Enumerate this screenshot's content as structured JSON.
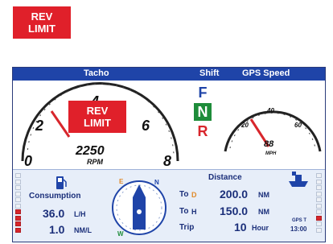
{
  "rev_limit_badge": {
    "line1": "REV",
    "line2": "LIMIT"
  },
  "header": {
    "tacho": "Tacho",
    "shift": "Shift",
    "gps_speed": "GPS Speed"
  },
  "tacho": {
    "ticks": [
      "0",
      "2",
      "4",
      "6",
      "8"
    ],
    "value": "2250",
    "unit": "RPM"
  },
  "shift": {
    "forward": "F",
    "neutral": "N",
    "reverse": "R",
    "active": "N"
  },
  "speedometer": {
    "ticks": [
      "20",
      "40",
      "60"
    ],
    "unit": "MPH",
    "reading": "88"
  },
  "consumption": {
    "label": "Consumption",
    "rate_value": "36.0",
    "rate_unit": "L/H",
    "economy_value": "1.0",
    "economy_unit": "NM/L"
  },
  "distance": {
    "title": "Distance",
    "rows": [
      {
        "label": "To",
        "marker": "D",
        "value": "200.0",
        "unit": "NM"
      },
      {
        "label": "To",
        "marker": "H",
        "value": "150.0",
        "unit": "NM"
      },
      {
        "label": "Trip",
        "marker": "",
        "value": "10",
        "unit": "Hour"
      }
    ]
  },
  "compass": {
    "north": "N",
    "west": "W",
    "east": "E"
  },
  "clock": {
    "label": "GPS T",
    "time": "13:00"
  },
  "colors": {
    "header_bg": "#1f44a8",
    "badge_red": "#e0202a",
    "text_blue": "#1b2f7a",
    "shift_green": "#1e8c3a",
    "gauge_needle": "#d8262c"
  }
}
